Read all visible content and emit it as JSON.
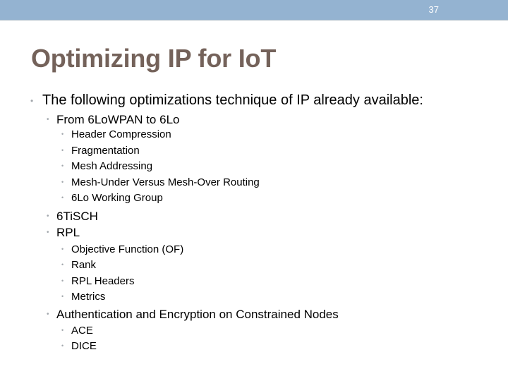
{
  "header": {
    "slide_number": "37",
    "bar_color": "#94b3d1"
  },
  "title": "Optimizing IP for IoT",
  "title_color": "#74625a",
  "bullet_glyph": "•",
  "body": {
    "intro": "The following optimizations technique of IP already available:",
    "sections": [
      {
        "label": "From 6LoWPAN to 6Lo",
        "items": [
          "Header Compression",
          "Fragmentation",
          "Mesh Addressing",
          "Mesh-Under Versus Mesh-Over Routing",
          "6Lo Working Group"
        ]
      },
      {
        "label": "6TiSCH",
        "items": []
      },
      {
        "label": "RPL",
        "items": [
          "Objective Function (OF)",
          "Rank",
          "RPL Headers",
          "Metrics"
        ]
      },
      {
        "label": "Authentication and Encryption on Constrained Nodes",
        "items": [
          "ACE",
          "DICE"
        ]
      }
    ]
  }
}
